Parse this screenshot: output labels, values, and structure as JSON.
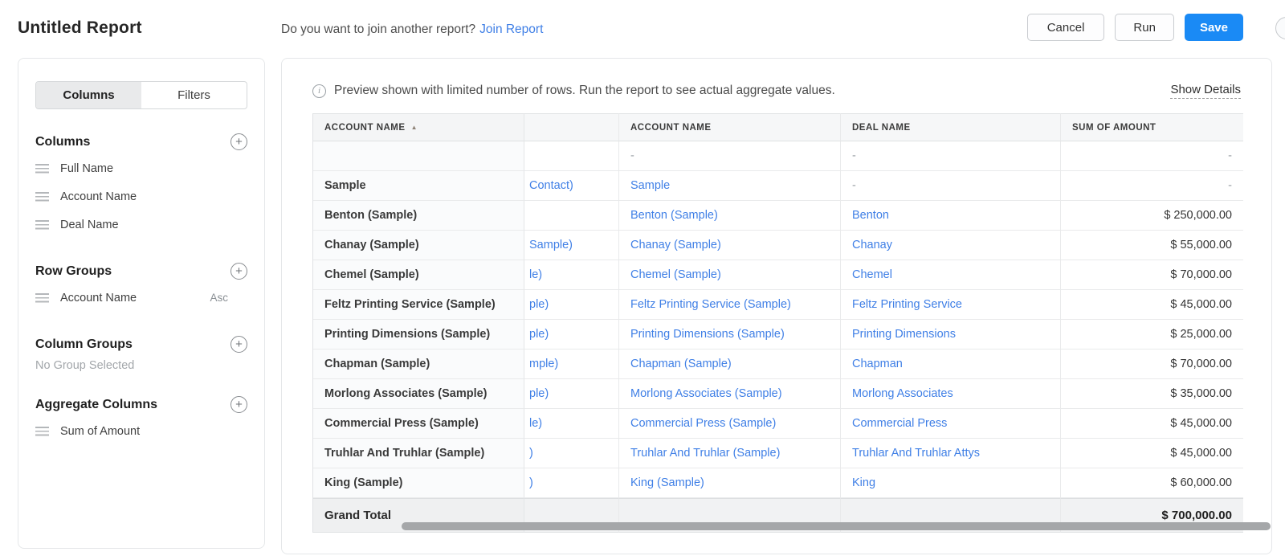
{
  "header": {
    "title": "Untitled Report",
    "join_prompt": "Do you want to join another report?",
    "join_link_label": "Join Report",
    "cancel_label": "Cancel",
    "run_label": "Run",
    "save_label": "Save"
  },
  "colors": {
    "accent": "#1a8af5",
    "link": "#3f7fe6"
  },
  "sidebar": {
    "tabs": [
      {
        "label": "Columns"
      },
      {
        "label": "Filters"
      }
    ],
    "active_tab": "Columns",
    "columns_section": {
      "title": "Columns",
      "items": [
        "Full Name",
        "Account Name",
        "Deal Name"
      ]
    },
    "row_groups_section": {
      "title": "Row Groups",
      "items": [
        {
          "label": "Account Name",
          "order": "Asc"
        }
      ]
    },
    "column_groups_section": {
      "title": "Column Groups",
      "empty_text": "No Group Selected"
    },
    "aggregate_section": {
      "title": "Aggregate Columns",
      "items": [
        "Sum of Amount"
      ]
    }
  },
  "main": {
    "info_text": "Preview shown with limited number of rows. Run the report to see actual aggregate values.",
    "show_details_label": "Show Details",
    "table": {
      "headers": [
        "ACCOUNT NAME",
        "",
        "ACCOUNT NAME",
        "DEAL NAME",
        "SUM OF AMOUNT"
      ],
      "sorted_header": "ACCOUNT NAME",
      "sort_direction": "asc",
      "rows": [
        {
          "group": "",
          "full_name_partial": "",
          "account": "-",
          "deal": "-",
          "amount": "-"
        },
        {
          "group": "Sample",
          "full_name_partial": "Contact)",
          "account": "Sample",
          "deal": "-",
          "amount": "-"
        },
        {
          "group": "Benton (Sample)",
          "full_name_partial": "",
          "account": "Benton (Sample)",
          "deal": "Benton",
          "amount": "$ 250,000.00"
        },
        {
          "group": "Chanay (Sample)",
          "full_name_partial": "Sample)",
          "account": "Chanay (Sample)",
          "deal": "Chanay",
          "amount": "$ 55,000.00"
        },
        {
          "group": "Chemel (Sample)",
          "full_name_partial": "le)",
          "account": "Chemel (Sample)",
          "deal": "Chemel",
          "amount": "$ 70,000.00"
        },
        {
          "group": "Feltz Printing Service (Sample)",
          "full_name_partial": "ple)",
          "account": "Feltz Printing Service (Sample)",
          "deal": "Feltz Printing Service",
          "amount": "$ 45,000.00"
        },
        {
          "group": "Printing Dimensions (Sample)",
          "full_name_partial": "ple)",
          "account": "Printing Dimensions (Sample)",
          "deal": "Printing Dimensions",
          "amount": "$ 25,000.00"
        },
        {
          "group": "Chapman (Sample)",
          "full_name_partial": "mple)",
          "account": "Chapman (Sample)",
          "deal": "Chapman",
          "amount": "$ 70,000.00"
        },
        {
          "group": "Morlong Associates (Sample)",
          "full_name_partial": "ple)",
          "account": "Morlong Associates (Sample)",
          "deal": "Morlong Associates",
          "amount": "$ 35,000.00"
        },
        {
          "group": "Commercial Press (Sample)",
          "full_name_partial": "le)",
          "account": "Commercial Press (Sample)",
          "deal": "Commercial Press",
          "amount": "$ 45,000.00"
        },
        {
          "group": "Truhlar And Truhlar (Sample)",
          "full_name_partial": ")",
          "account": "Truhlar And Truhlar (Sample)",
          "deal": "Truhlar And Truhlar Attys",
          "amount": "$ 45,000.00"
        },
        {
          "group": "King (Sample)",
          "full_name_partial": ")",
          "account": "King (Sample)",
          "deal": "King",
          "amount": "$ 60,000.00"
        }
      ],
      "grand_total_label": "Grand Total",
      "grand_total_amount": "$ 700,000.00"
    }
  }
}
